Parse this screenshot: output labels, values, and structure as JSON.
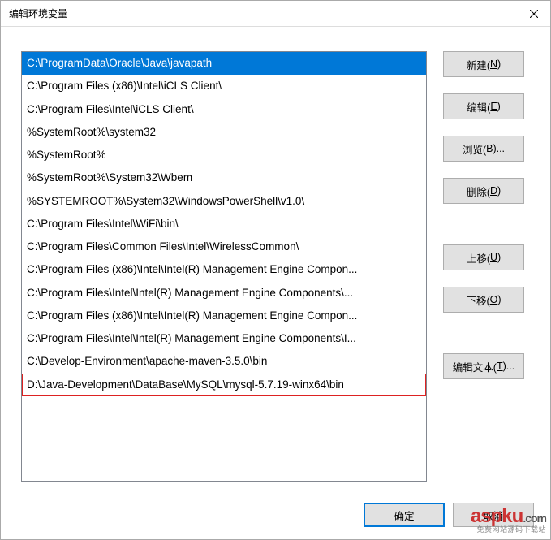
{
  "window": {
    "title": "编辑环境变量",
    "close_tooltip": "关闭"
  },
  "list": {
    "items": [
      "C:\\ProgramData\\Oracle\\Java\\javapath",
      "C:\\Program Files (x86)\\Intel\\iCLS Client\\",
      "C:\\Program Files\\Intel\\iCLS Client\\",
      "%SystemRoot%\\system32",
      "%SystemRoot%",
      "%SystemRoot%\\System32\\Wbem",
      "%SYSTEMROOT%\\System32\\WindowsPowerShell\\v1.0\\",
      "C:\\Program Files\\Intel\\WiFi\\bin\\",
      "C:\\Program Files\\Common Files\\Intel\\WirelessCommon\\",
      "C:\\Program Files (x86)\\Intel\\Intel(R) Management Engine Compon...",
      "C:\\Program Files\\Intel\\Intel(R) Management Engine Components\\...",
      "C:\\Program Files (x86)\\Intel\\Intel(R) Management Engine Compon...",
      "C:\\Program Files\\Intel\\Intel(R) Management Engine Components\\I...",
      "C:\\Develop-Environment\\apache-maven-3.5.0\\bin",
      "D:\\Java-Development\\DataBase\\MySQL\\mysql-5.7.19-winx64\\bin"
    ],
    "selected_index": 0,
    "highlighted_index": 14
  },
  "buttons": {
    "new": {
      "text": "新建(",
      "accel": "N",
      "suffix": ")"
    },
    "edit": {
      "text": "编辑(",
      "accel": "E",
      "suffix": ")"
    },
    "browse": {
      "text": "浏览(",
      "accel": "B",
      "suffix": ")..."
    },
    "delete": {
      "text": "删除(",
      "accel": "D",
      "suffix": ")"
    },
    "move_up": {
      "text": "上移(",
      "accel": "U",
      "suffix": ")"
    },
    "move_down": {
      "text": "下移(",
      "accel": "O",
      "suffix": ")"
    },
    "edit_text": {
      "text": "编辑文本(",
      "accel": "T",
      "suffix": ")..."
    }
  },
  "footer": {
    "ok": "确定",
    "cancel": "取消"
  },
  "watermark": {
    "main": "aspku",
    "suffix": ".com",
    "sub": "免费网站源码下载站"
  }
}
